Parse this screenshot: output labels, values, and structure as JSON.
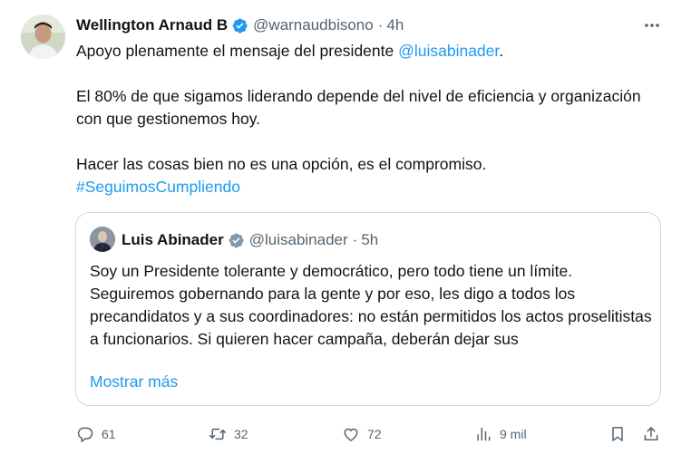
{
  "tweet": {
    "author_name": "Wellington Arnaud B",
    "handle": "@warnaudbisono",
    "separator": "·",
    "time": "4h",
    "text_line1_prefix": "Apoyo plenamente el mensaje del presidente ",
    "mention": "@luisabinader",
    "text_line1_suffix": ".",
    "paragraph2": "El 80% de que sigamos liderando depende del nivel de eficiencia y organización con que gestionemos hoy.",
    "paragraph3": "Hacer las cosas bien no es una opción, es el compromiso.",
    "hashtag": "#SeguimosCumpliendo"
  },
  "quote": {
    "author_name": "Luis Abinader",
    "handle": "@luisabinader",
    "separator": "·",
    "time": "5h",
    "text": "Soy un Presidente tolerante y democrático, pero todo tiene un límite. Seguiremos gobernando para la gente y por eso, les digo a todos los precandidatos y a sus coordinadores: no están permitidos los actos proselitistas a funcionarios. Si quieren hacer campaña, deberán dejar sus",
    "show_more": "Mostrar más"
  },
  "actions": {
    "replies": "61",
    "retweets": "32",
    "likes": "72",
    "views": "9 mil"
  },
  "colors": {
    "link": "#1d9bf0",
    "secondary_text": "#536471",
    "border": "#cfd9de",
    "verified": "#1d9bf0",
    "verified_gray": "#829aab"
  },
  "icons": [
    "more-icon",
    "verified-icon",
    "reply-icon",
    "retweet-icon",
    "like-icon",
    "views-icon",
    "bookmark-icon",
    "share-icon"
  ]
}
